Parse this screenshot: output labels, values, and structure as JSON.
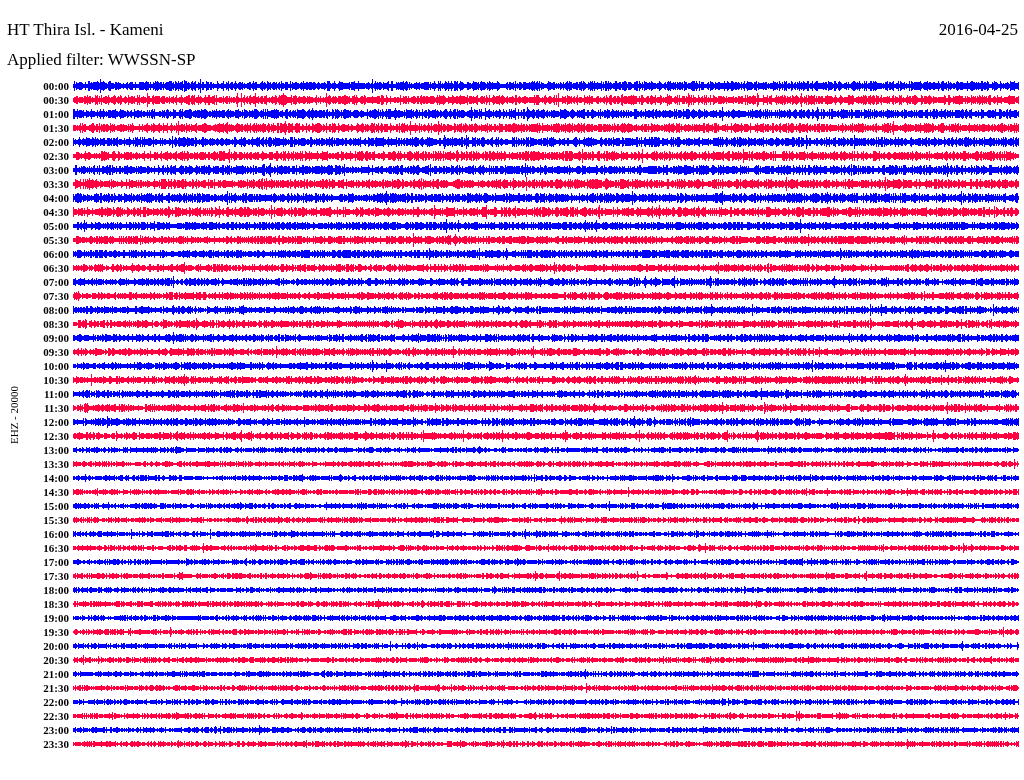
{
  "header": {
    "station": "HT Thira Isl. - Kameni",
    "date": "2016-04-25",
    "filter": "Applied filter: WWSSN-SP"
  },
  "chart": {
    "axis_label": "EHZ - 20000",
    "traces": [
      {
        "time": "00:00",
        "color": "#0000ff"
      },
      {
        "time": "00:30",
        "color": "#ff0040"
      },
      {
        "time": "01:00",
        "color": "#0000ff"
      },
      {
        "time": "01:30",
        "color": "#ff0040"
      },
      {
        "time": "02:00",
        "color": "#0000ff"
      },
      {
        "time": "02:30",
        "color": "#ff0040"
      },
      {
        "time": "03:00",
        "color": "#0000ff"
      },
      {
        "time": "03:30",
        "color": "#ff0040"
      },
      {
        "time": "04:00",
        "color": "#0000ff"
      },
      {
        "time": "04:30",
        "color": "#ff0040"
      },
      {
        "time": "05:00",
        "color": "#0000ff"
      },
      {
        "time": "05:30",
        "color": "#ff0040"
      },
      {
        "time": "06:00",
        "color": "#0000ff"
      },
      {
        "time": "06:30",
        "color": "#ff0040"
      },
      {
        "time": "07:00",
        "color": "#0000ff"
      },
      {
        "time": "07:30",
        "color": "#ff0040"
      },
      {
        "time": "08:00",
        "color": "#0000ff"
      },
      {
        "time": "08:30",
        "color": "#ff0040"
      },
      {
        "time": "09:00",
        "color": "#0000ff"
      },
      {
        "time": "09:30",
        "color": "#ff0040"
      },
      {
        "time": "10:00",
        "color": "#0000ff"
      },
      {
        "time": "10:30",
        "color": "#ff0040"
      },
      {
        "time": "11:00",
        "color": "#0000ff"
      },
      {
        "time": "11:30",
        "color": "#ff0040"
      },
      {
        "time": "12:00",
        "color": "#0000ff"
      },
      {
        "time": "12:30",
        "color": "#ff0040"
      },
      {
        "time": "13:00",
        "color": "#0000ff"
      },
      {
        "time": "13:30",
        "color": "#ff0040"
      },
      {
        "time": "14:00",
        "color": "#0000ff"
      },
      {
        "time": "14:30",
        "color": "#ff0040"
      },
      {
        "time": "15:00",
        "color": "#0000ff"
      },
      {
        "time": "15:30",
        "color": "#ff0040"
      },
      {
        "time": "16:00",
        "color": "#0000ff"
      },
      {
        "time": "16:30",
        "color": "#ff0040"
      },
      {
        "time": "17:00",
        "color": "#0000ff"
      },
      {
        "time": "17:30",
        "color": "#ff0040"
      },
      {
        "time": "18:00",
        "color": "#0000ff"
      },
      {
        "time": "18:30",
        "color": "#ff0040"
      },
      {
        "time": "19:00",
        "color": "#0000ff"
      },
      {
        "time": "19:30",
        "color": "#ff0040"
      },
      {
        "time": "20:00",
        "color": "#0000ff"
      },
      {
        "time": "20:30",
        "color": "#ff0040"
      },
      {
        "time": "21:00",
        "color": "#0000ff"
      },
      {
        "time": "21:30",
        "color": "#ff0040"
      },
      {
        "time": "22:00",
        "color": "#0000ff"
      },
      {
        "time": "22:30",
        "color": "#ff0040"
      },
      {
        "time": "23:00",
        "color": "#0000ff"
      },
      {
        "time": "23:30",
        "color": "#ff0040"
      }
    ]
  }
}
